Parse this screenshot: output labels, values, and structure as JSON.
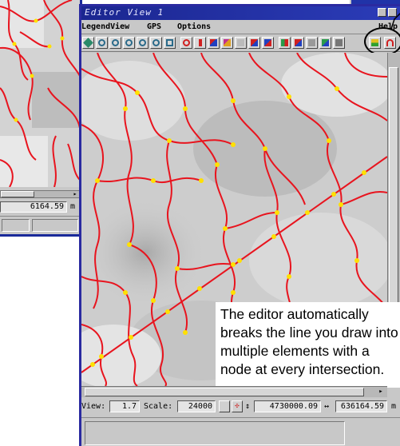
{
  "back_window": {
    "coordinate": "6164.59",
    "unit": "m",
    "scroll_arrow": "▸"
  },
  "front_window": {
    "title": "Editor View 1",
    "menu": [
      "LegendView",
      "GPS",
      "Options"
    ],
    "help": "Help",
    "toolbar_icons": [
      "fit-view-icon",
      "zoom-in-icon",
      "zoom-out-icon",
      "zoom-box-icon",
      "zoom-1x-icon",
      "full-view-icon",
      "pan-icon",
      "find-icon",
      "select-point-icon",
      "select-line-icon",
      "select-polygon-icon",
      "measure-icon",
      "layer-icon",
      "legend-icon",
      "gps-icon",
      "table-icon",
      "grid-icon",
      "edit-icon",
      "exit-icon"
    ],
    "callout": "The editor automatically breaks the line you draw into multiple elements with a node at every intersection.",
    "status": {
      "view_label": "View:",
      "view_value": "1.7",
      "scale_label": "Scale:",
      "scale_value": "24000",
      "northing": "4730000.09",
      "arrow": "↔",
      "easting": "636164.59",
      "unit": "m"
    },
    "scroll_arrow": "▸"
  },
  "colors": {
    "line": "#e8141e",
    "node": "#ffe000",
    "title_bar": "#1b2690",
    "chrome": "#c8c8c8"
  }
}
